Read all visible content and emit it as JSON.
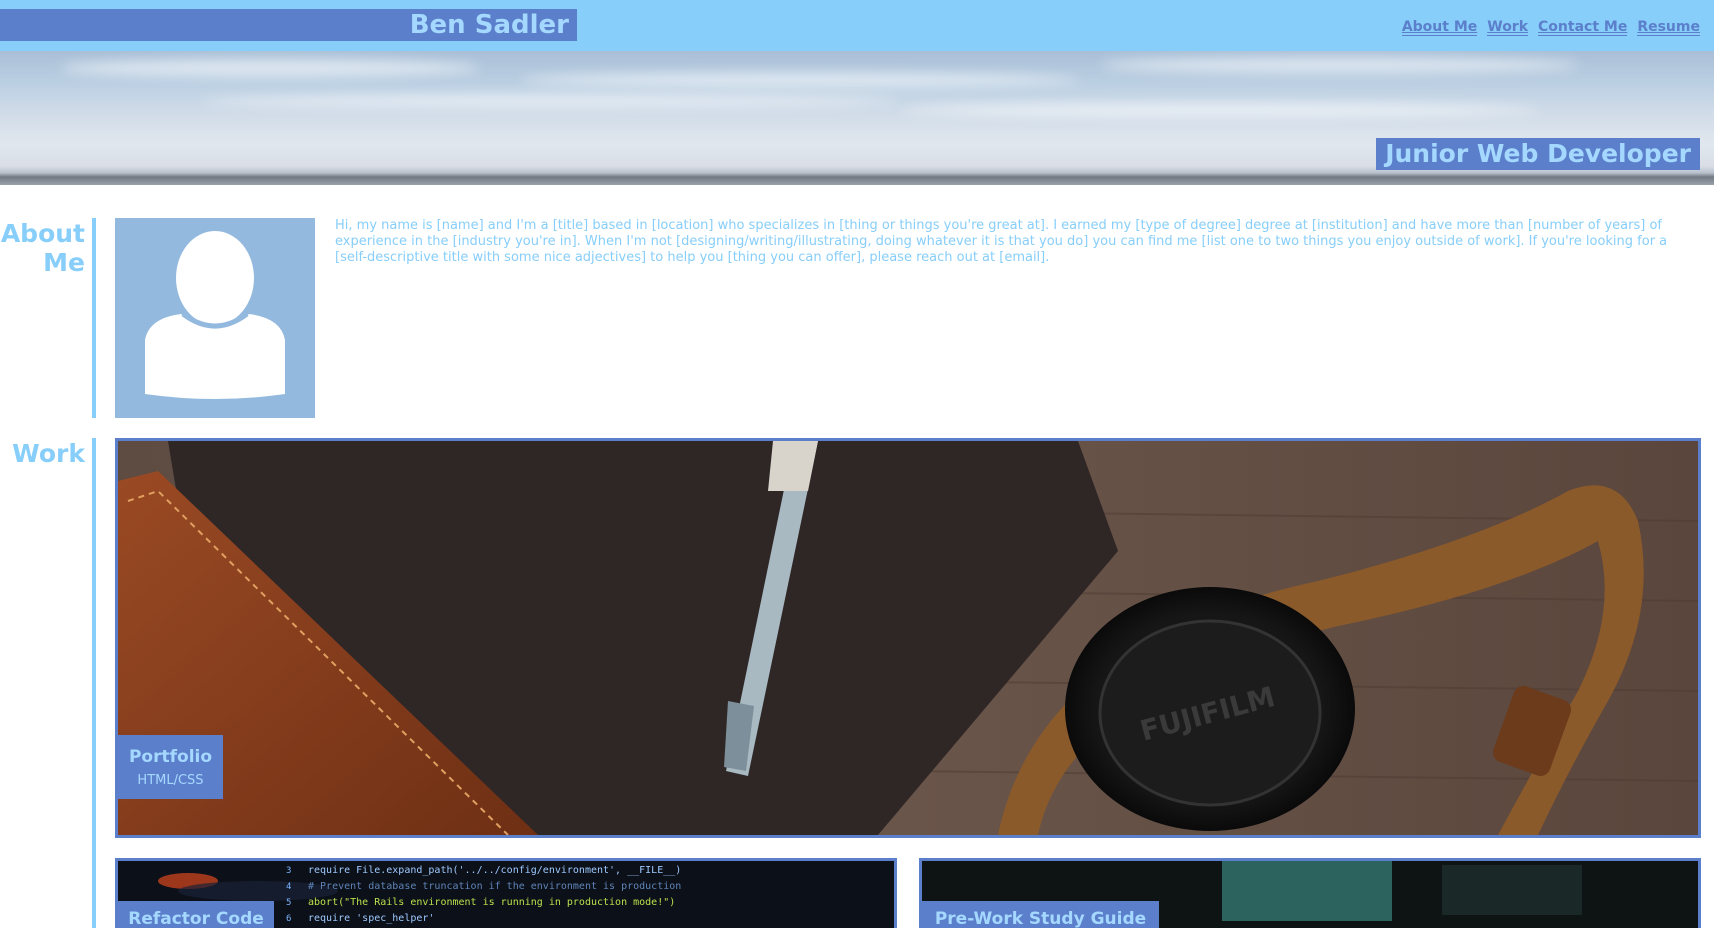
{
  "header": {
    "brand": "Ben Sadler",
    "nav": [
      "About Me",
      "Work",
      "Contact Me",
      "Resume"
    ]
  },
  "hero": {
    "title": "Junior Web Developer"
  },
  "about": {
    "label_line1": "About",
    "label_line2": "Me",
    "avatar_icon": "user-silhouette-icon",
    "text": "Hi, my name is [name] and I'm a [title] based in [location] who specializes in [thing or things you're great at]. I earned my [type of degree] degree at [institution] and have more than [number of years] of experience in the [industry you're in]. When I'm not [designing/writing/illustrating, doing whatever it is that you do] you can find me [list one to two things you enjoy outside of work]. If you're looking for a [self-descriptive title with some nice adjectives] to help you [thing you can offer], please reach out at [email]."
  },
  "work": {
    "label": "Work",
    "featured": {
      "title": "Portfolio",
      "subtitle": "HTML/CSS"
    },
    "projects": [
      {
        "title": "Refactor Code"
      },
      {
        "title": "Pre-Work Study Guide"
      }
    ],
    "code_lines": [
      "require File.expand_path('../../config/environment', __FILE__)",
      "# Prevent database truncation if the environment is production",
      "abort(\"The Rails environment is running in production mode!\")",
      "require 'spec_helper'"
    ],
    "code_line_numbers": [
      "3",
      "4",
      "5",
      "6"
    ]
  },
  "colors": {
    "header_bg": "#87cefa",
    "accent": "#5b7fcb",
    "text_light": "#a5d8ff"
  }
}
